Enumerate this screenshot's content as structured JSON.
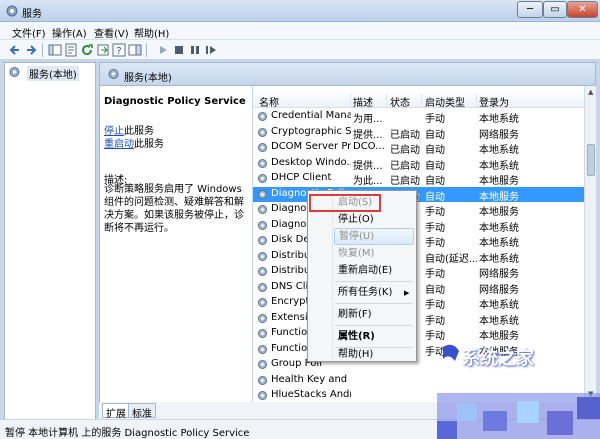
{
  "window": {
    "title": "服务",
    "min": "─",
    "max": "▭",
    "close": "✕"
  },
  "menu": [
    "文件(F)",
    "操作(A)",
    "查看(V)",
    "帮助(H)"
  ],
  "tree": {
    "root": "服务(本地)"
  },
  "pane_header": "服务(本地)",
  "detail": {
    "title": "Diagnostic Policy Service",
    "stop_link": "停止",
    "stop_suffix": "此服务",
    "restart_link": "重启动",
    "restart_suffix": "此服务",
    "desc_label": "描述:",
    "desc_text": "诊断策略服务启用了 Windows 组件的问题检测、疑难解答和解决方案。如果该服务被停止，诊断将不再运行。"
  },
  "columns": [
    "名称",
    "描述",
    "状态",
    "启动类型",
    "登录为"
  ],
  "rows": [
    {
      "name": "Credential Mana...",
      "desc": "为用...",
      "status": "",
      "start": "手动",
      "logon": "本地系统"
    },
    {
      "name": "Cryptographic S...",
      "desc": "提供...",
      "status": "已启动",
      "start": "自动",
      "logon": "网络服务"
    },
    {
      "name": "DCOM Server Pr...",
      "desc": "DCO...",
      "status": "已启动",
      "start": "自动",
      "logon": "本地系统"
    },
    {
      "name": "Desktop Windo...",
      "desc": "提供...",
      "status": "已启动",
      "start": "自动",
      "logon": "本地系统"
    },
    {
      "name": "DHCP Client",
      "desc": "为此...",
      "status": "已启动",
      "start": "自动",
      "logon": "本地服务"
    },
    {
      "name": "Diagnostic Polic...",
      "desc": "诊断...",
      "status": "已启动",
      "start": "自动",
      "logon": "本地服务"
    },
    {
      "name": "Diagnos",
      "desc": "",
      "status": "",
      "start": "手动",
      "logon": "本地服务"
    },
    {
      "name": "Diagnos",
      "desc": "",
      "status": "",
      "start": "手动",
      "logon": "本地系统"
    },
    {
      "name": "Disk Def",
      "desc": "",
      "status": "",
      "start": "手动",
      "logon": "本地系统"
    },
    {
      "name": "Distribut",
      "desc": "",
      "status": "",
      "start": "自动(延迟...",
      "logon": "本地系统"
    },
    {
      "name": "Distribut",
      "desc": "",
      "status": "",
      "start": "手动",
      "logon": "网络服务"
    },
    {
      "name": "DNS Clie",
      "desc": "",
      "status": "",
      "start": "自动",
      "logon": "网络服务"
    },
    {
      "name": "Encrypti",
      "desc": "",
      "status": "",
      "start": "手动",
      "logon": "本地系统"
    },
    {
      "name": "Extensib",
      "desc": "",
      "status": "",
      "start": "手动",
      "logon": "本地系统"
    },
    {
      "name": "Function",
      "desc": "",
      "status": "",
      "start": "手动",
      "logon": "本地服务"
    },
    {
      "name": "Function",
      "desc": "",
      "status": "",
      "start": "手动",
      "logon": "本地服务"
    },
    {
      "name": "Group Poli",
      "desc": "",
      "status": "",
      "start": "",
      "logon": ""
    },
    {
      "name": "Health Key and ...",
      "desc": "",
      "status": "",
      "start": "",
      "logon": ""
    },
    {
      "name": "HlueStacks Andr...",
      "desc": "",
      "status": "",
      "start": "",
      "logon": ""
    }
  ],
  "context_menu": {
    "start": "启动(S)",
    "stop": "停止(O)",
    "pause": "暂停(U)",
    "resume": "恢复(M)",
    "restart": "重新启动(E)",
    "all_tasks": "所有任务(K)",
    "refresh": "刷新(F)",
    "properties": "属性(R)",
    "help": "帮助(H)"
  },
  "tabs": [
    "扩展",
    "标准"
  ],
  "status": "暂停 本地计算机 上的服务 Diagnostic Policy Service",
  "watermark": "系统之家",
  "colors": {
    "selection": "#3399ff",
    "link": "#1c4fb8",
    "highlight_box": "#e03a3a"
  }
}
